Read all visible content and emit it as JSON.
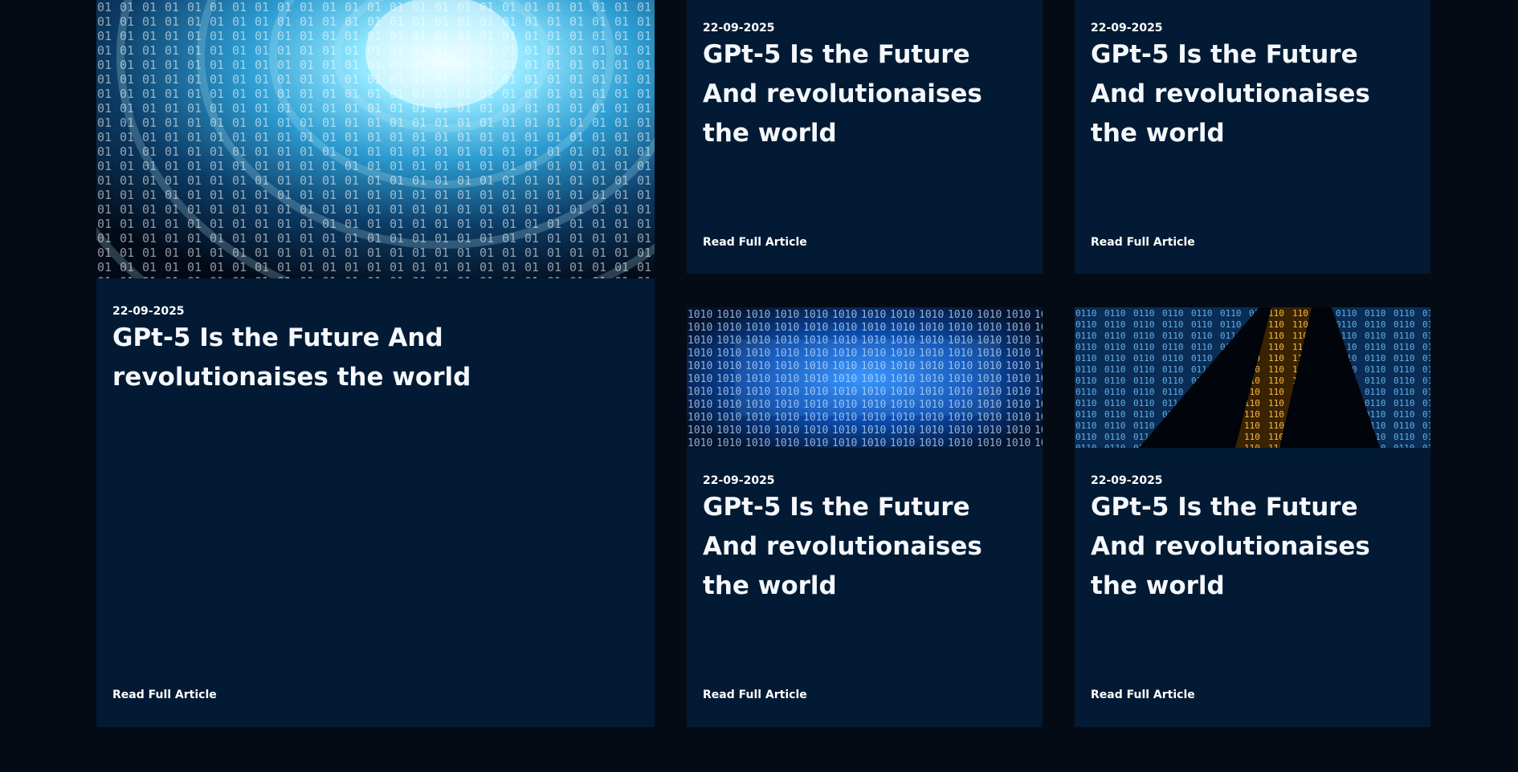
{
  "theme": {
    "background": "#050b14",
    "card_background": "#021a33",
    "text": "#ffffff",
    "image_tint_blue": "#1e90ff",
    "image_tint_amber": "#f5a623"
  },
  "articles": [
    {
      "date": "22-09-2025",
      "title": "GPt-5 Is the Future And revolutionaises the world",
      "link_label": "Read Full Article",
      "image": "binary-tunnel-image"
    },
    {
      "date": "22-09-2025",
      "title": "GPt-5 Is the Future And revolutionaises the world",
      "link_label": "Read Full Article",
      "image": null
    },
    {
      "date": "22-09-2025",
      "title": "GPt-5 Is the Future And revolutionaises the world",
      "link_label": "Read Full Article",
      "image": null
    },
    {
      "date": "22-09-2025",
      "title": "GPt-5 Is the Future And revolutionaises the world",
      "link_label": "Read Full Article",
      "image": "binary-code-blue-image"
    },
    {
      "date": "22-09-2025",
      "title": "GPt-5 Is the Future And revolutionaises the world",
      "link_label": "Read Full Article",
      "image": "binary-code-amber-image"
    }
  ]
}
